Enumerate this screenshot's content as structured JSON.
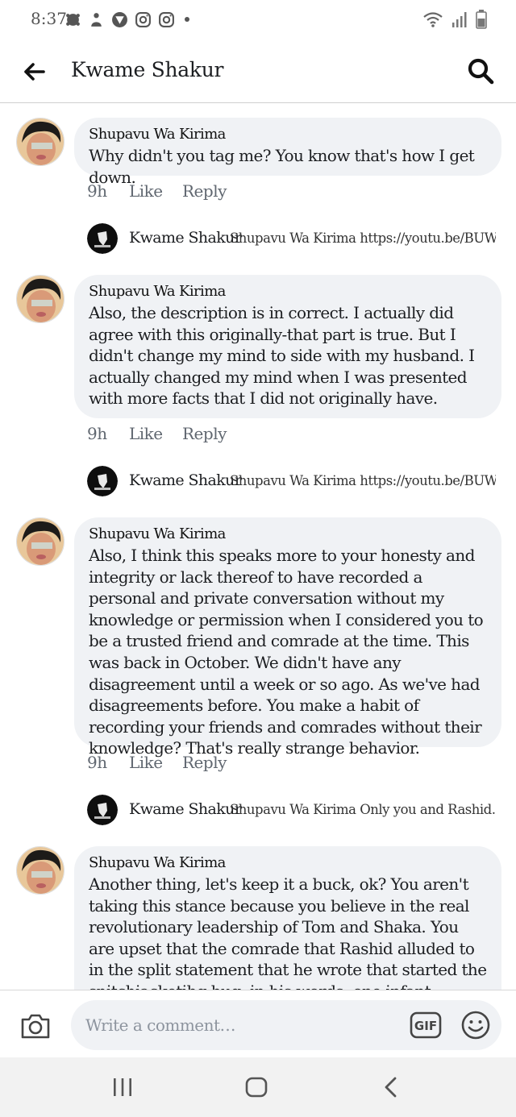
{
  "status_bar": {
    "time": "8:37",
    "icons_left": [
      "notification-icon",
      "person-icon",
      "vpn-icon",
      "instagram-icon",
      "instagram-icon"
    ],
    "icons_right": [
      "wifi-icon",
      "signal-icon",
      "battery-icon"
    ]
  },
  "header": {
    "title": "Kwame Shakur"
  },
  "comments": [
    {
      "author": "Shupavu Wa Kirima",
      "text": "Why didn't you tag me? You know that's how I get down.",
      "time": "9h",
      "like": "Like",
      "reply": "Reply",
      "reply_preview": {
        "author": "Kwame Shakur",
        "text": "Shupavu Wa Kirima https://youtu.be/BUW…"
      }
    },
    {
      "author": "Shupavu Wa Kirima",
      "text": "Also, the description is in correct. I actually did agree with this originally-that part is true. But I didn't change my mind to side with my husband. I actually changed my mind when I was presented with more facts that I did not originally have.",
      "time": "9h",
      "like": "Like",
      "reply": "Reply",
      "reply_preview": {
        "author": "Kwame Shakur",
        "text": "Shupavu Wa Kirima https://youtu.be/BUW…"
      }
    },
    {
      "author": "Shupavu Wa Kirima",
      "text": "Also, I think this speaks more to your honesty and integrity or lack thereof to have recorded a personal and private conversation without my knowledge or permission when I considered you to be a trusted friend and comrade at the time. This was back in October. We didn't have any disagreement until a week or so ago. As we've had disagreements before. You make a habit of recording your friends and comrades without their knowledge? That's really strange behavior.",
      "time": "9h",
      "like": "Like",
      "reply": "Reply",
      "reply_preview": {
        "author": "Kwame Shakur",
        "text": "Shupavu Wa Kirima Only you and Rashid. …"
      }
    },
    {
      "author": "Shupavu Wa Kirima",
      "text": "Another thing, let's keep it a buck, ok? You aren't taking this stance because you believe in the  real revolutionary leadership of Tom and Shaka. You are upset that the comrade that Rashid alluded to in the split statement that he wrote that started the snitchjacketibg bug, in his words, one infant...",
      "time": "",
      "like": "",
      "reply": ""
    }
  ],
  "composer": {
    "placeholder": "Write a comment…",
    "gif_label": "GIF"
  },
  "colors": {
    "bubble": "#f0f2f5",
    "meta_text": "#606770",
    "navbar": "#f2f2f2"
  }
}
